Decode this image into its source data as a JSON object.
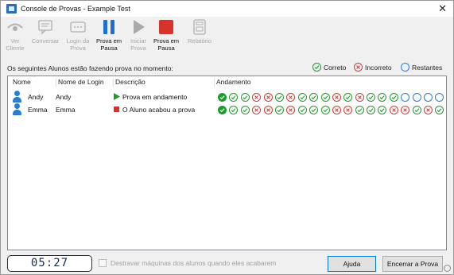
{
  "window": {
    "title": "Console de Provas - Example Test",
    "close_glyph": "✕"
  },
  "toolbar": {
    "buttons": [
      {
        "label": "Ver\nCliente",
        "icon": "eye-icon",
        "enabled": false
      },
      {
        "label": "Conversar",
        "icon": "chat-icon",
        "enabled": false
      },
      {
        "label": "Login da\nProva",
        "icon": "login-icon",
        "enabled": false
      },
      {
        "label": "Prova em\nPausa",
        "icon": "pause-icon",
        "enabled": true
      },
      {
        "label": "Iniciar\nProva",
        "icon": "play-icon",
        "enabled": false
      },
      {
        "label": "Prova em\nPausa",
        "icon": "stop-icon",
        "enabled": true
      },
      {
        "label": "Relatório",
        "icon": "report-icon",
        "enabled": false
      }
    ]
  },
  "status_line": "Os seguintes Alunos estão fazendo prova no momento:",
  "legend": {
    "correct": "Correto",
    "incorrect": "Incorreto",
    "remaining": "Restantes"
  },
  "table": {
    "headers": {
      "name": "Nome",
      "login": "Nome de Login",
      "description": "Descrição",
      "progress": "Andamento"
    },
    "rows": [
      {
        "name": "Andy",
        "login": "Andy",
        "status_icon": "play-status-icon",
        "description": "Prova em andamento",
        "progress": [
          "current",
          "correct",
          "correct",
          "incorrect",
          "incorrect",
          "correct",
          "incorrect",
          "correct",
          "correct",
          "correct",
          "incorrect",
          "correct",
          "incorrect",
          "correct",
          "correct",
          "correct",
          "remaining",
          "remaining",
          "remaining",
          "remaining"
        ]
      },
      {
        "name": "Emma",
        "login": "Emma",
        "status_icon": "stop-status-icon",
        "description": "O Aluno acabou a prova",
        "progress": [
          "current",
          "correct",
          "correct",
          "incorrect",
          "incorrect",
          "correct",
          "incorrect",
          "correct",
          "correct",
          "correct",
          "incorrect",
          "incorrect",
          "correct",
          "correct",
          "correct",
          "incorrect",
          "incorrect",
          "correct",
          "incorrect",
          "correct"
        ]
      }
    ]
  },
  "footer": {
    "timer": "05:27",
    "checkbox_label": "Destravar máquinas dos alunos quando eles acabarem",
    "checkbox_checked": false,
    "help_button": "Ajuda",
    "end_button": "Encerrar a Prova"
  },
  "colors": {
    "correct": "#1f9a2e",
    "incorrect": "#d23b3b",
    "remaining": "#2a7dd1",
    "accent": "#1d6fd1",
    "stop": "#d8322d"
  }
}
